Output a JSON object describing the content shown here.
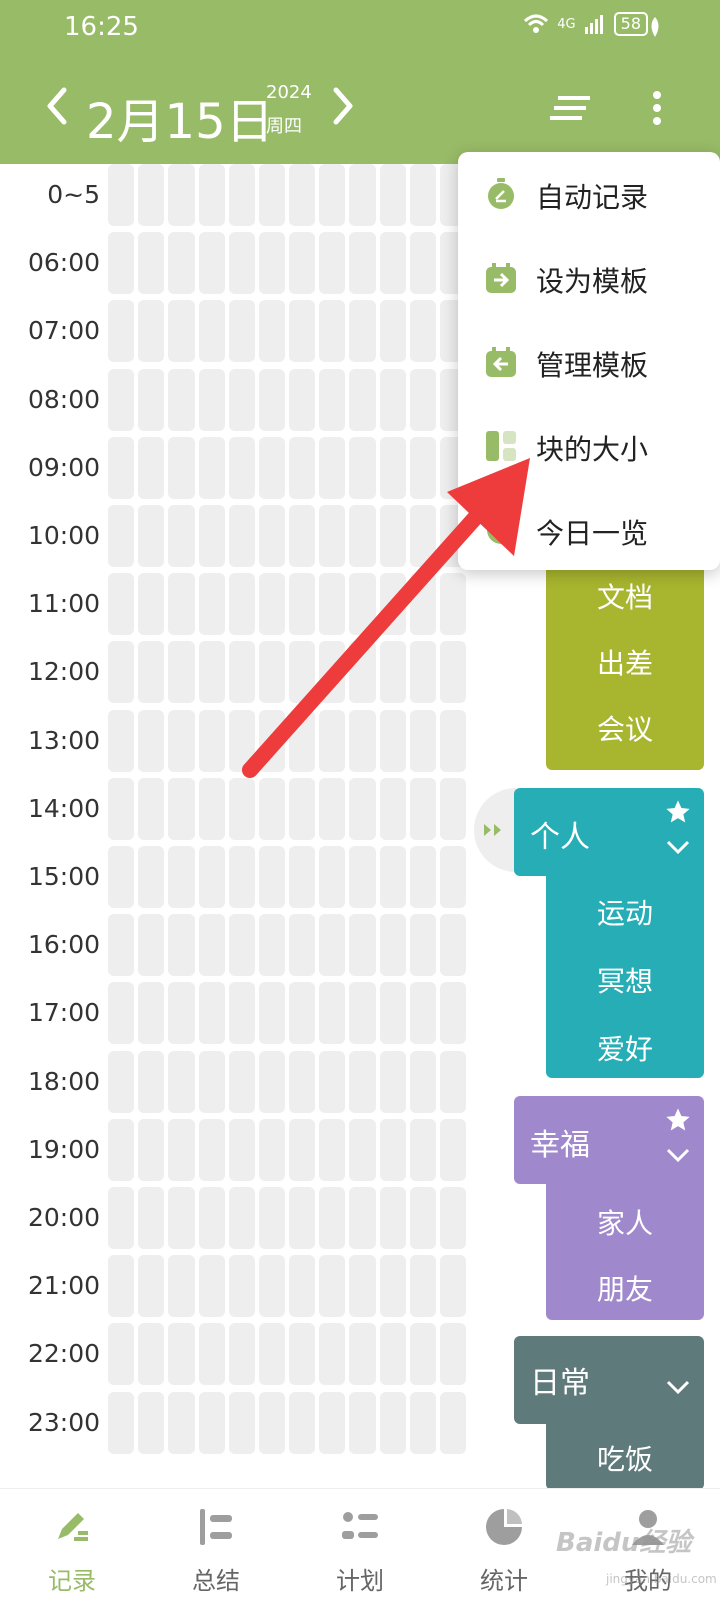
{
  "status_bar": {
    "time": "16:25",
    "network": "4G",
    "battery": "58"
  },
  "header": {
    "date": "2月15日",
    "year": "2024",
    "weekday": "周四",
    "accent_color": "#98bb67"
  },
  "timeline": {
    "hours": [
      "0~5",
      "06:00",
      "07:00",
      "08:00",
      "09:00",
      "10:00",
      "11:00",
      "12:00",
      "13:00",
      "14:00",
      "15:00",
      "16:00",
      "17:00",
      "18:00",
      "19:00",
      "20:00",
      "21:00",
      "22:00",
      "23:00"
    ],
    "cell_color": "#eeeeee"
  },
  "menu": {
    "items": [
      {
        "label": "自动记录",
        "icon": "stopwatch-icon"
      },
      {
        "label": "设为模板",
        "icon": "template-save-icon"
      },
      {
        "label": "管理模板",
        "icon": "template-manage-icon"
      },
      {
        "label": "块的大小",
        "icon": "block-size-icon"
      },
      {
        "label": "今日一览",
        "icon": "overview-icon"
      }
    ]
  },
  "categories": {
    "work": {
      "color": "#a8b52e",
      "items": [
        "文档",
        "出差",
        "会议"
      ]
    },
    "personal": {
      "name": "个人",
      "color": "#26adb5",
      "items": [
        "运动",
        "冥想",
        "爱好"
      ]
    },
    "happiness": {
      "name": "幸福",
      "color": "#9f88cc",
      "items": [
        "家人",
        "朋友"
      ]
    },
    "daily": {
      "name": "日常",
      "color": "#5f7a7b",
      "items": [
        "吃饭"
      ]
    }
  },
  "bottom_nav": {
    "tabs": [
      {
        "label": "记录",
        "icon": "pen-icon",
        "active": true
      },
      {
        "label": "总结",
        "icon": "summary-icon",
        "active": false
      },
      {
        "label": "计划",
        "icon": "plan-icon",
        "active": false
      },
      {
        "label": "统计",
        "icon": "pie-chart-icon",
        "active": false
      },
      {
        "label": "我的",
        "icon": "user-icon",
        "active": false
      }
    ]
  },
  "watermark": {
    "brand": "Baidu经验",
    "url": "jingyan.baidu.com"
  }
}
